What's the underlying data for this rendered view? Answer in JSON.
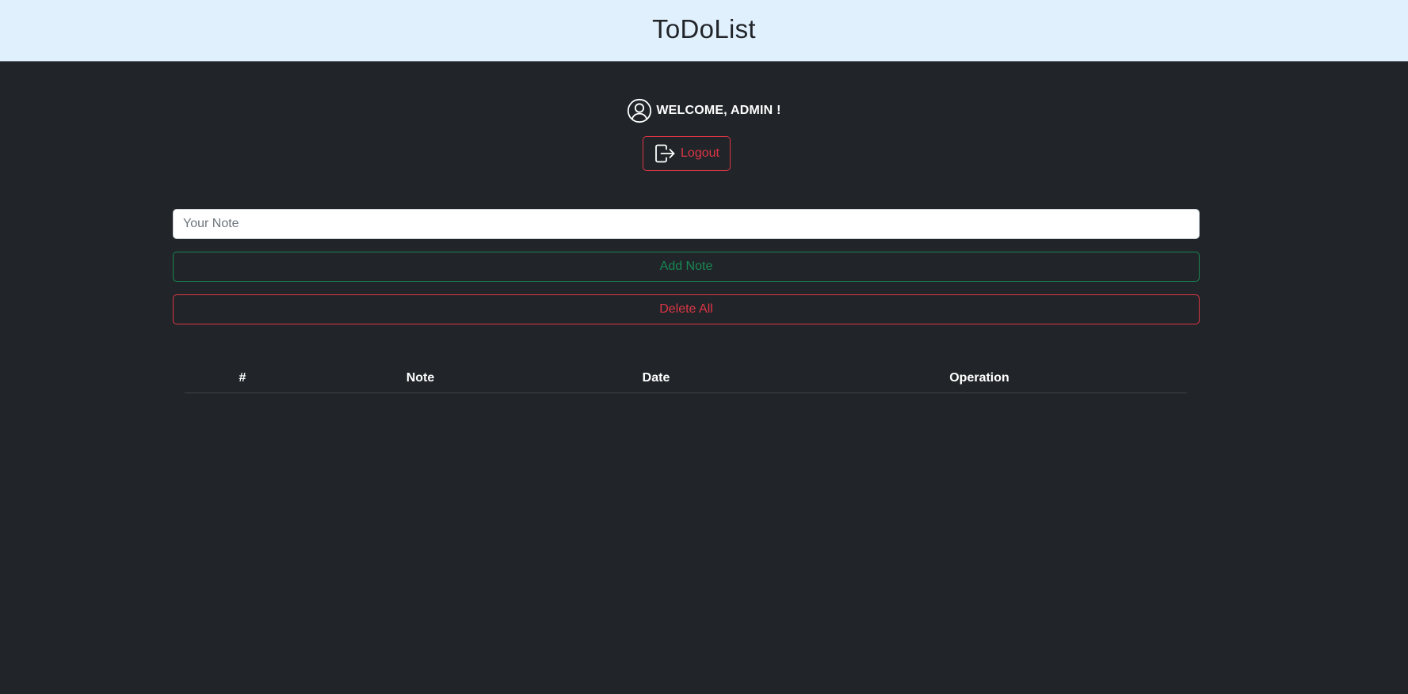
{
  "app": {
    "title": "ToDoList"
  },
  "user": {
    "welcome_text": "WELCOME, ADMIN !",
    "icon": "person-circle-icon"
  },
  "logout": {
    "label": "Logout",
    "icon": "box-arrow-right-icon"
  },
  "note_input": {
    "placeholder": "Your Note",
    "value": ""
  },
  "buttons": {
    "add_label": "Add Note",
    "delete_all_label": "Delete All"
  },
  "table": {
    "columns": [
      "#",
      "Note",
      "Date",
      "Operation"
    ],
    "rows": []
  },
  "colors": {
    "navbar_bg": "#e0f0fc",
    "page_bg": "#212529",
    "success": "#198754",
    "danger": "#dc3545"
  }
}
